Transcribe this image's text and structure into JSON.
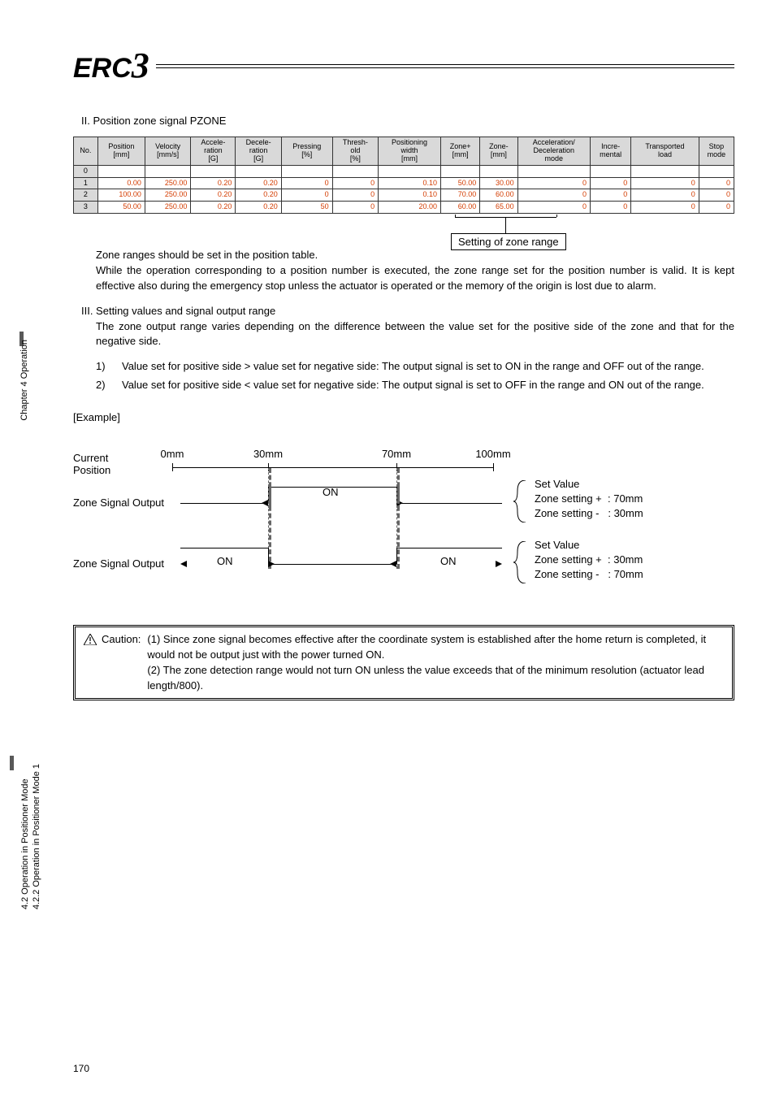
{
  "logo_text": "ERC3",
  "section2_title": "II. Position zone signal PZONE",
  "table": {
    "headers": [
      "No.",
      "Position\n[mm]",
      "Velocity\n[mm/s]",
      "Acceleration\n[G]",
      "Deceleration\n[G]",
      "Pressing\n[%]",
      "Threshold\n[%]",
      "Positioning\nwidth\n[mm]",
      "Zone+\n[mm]",
      "Zone-\n[mm]",
      "Acceleration/\nDeceleration\nmode",
      "Incremental",
      "Transported\nload",
      "Stop\nmode"
    ],
    "h0": "No.",
    "h1": "Position [mm]",
    "h2": "Velocity [mm/s]",
    "h3": "Acceleration [G]",
    "h4": "Deceleration [G]",
    "h5": "Pressing [%]",
    "h6": "Threshold [%]",
    "h7": "Positioning width [mm]",
    "h8": "Zone+ [mm]",
    "h9": "Zone- [mm]",
    "h10": "Acceleration/ Deceleration mode",
    "h11": "Incremental",
    "h12": "Transported load",
    "h13": "Stop mode",
    "rows": [
      {
        "no": "0",
        "cells": [
          "",
          "",
          "",
          "",
          "",
          "",
          "",
          "",
          "",
          "",
          "",
          "",
          ""
        ]
      },
      {
        "no": "1",
        "cells": [
          "0.00",
          "250.00",
          "0.20",
          "0.20",
          "0",
          "0",
          "0.10",
          "50.00",
          "30.00",
          "0",
          "0",
          "0",
          "0"
        ]
      },
      {
        "no": "2",
        "cells": [
          "100.00",
          "250.00",
          "0.20",
          "0.20",
          "0",
          "0",
          "0.10",
          "70.00",
          "60.00",
          "0",
          "0",
          "0",
          "0"
        ]
      },
      {
        "no": "3",
        "cells": [
          "50.00",
          "250.00",
          "0.20",
          "0.20",
          "50",
          "0",
          "20.00",
          "60.00",
          "65.00",
          "0",
          "0",
          "0",
          "0"
        ]
      }
    ]
  },
  "callout": "Setting of zone range",
  "para1": "Zone ranges should be set in the position table.\nWhile the operation corresponding to a position number is executed, the zone range set for the position number is valid. It is kept effective also during the emergency stop unless the actuator is operated or the memory of the origin is lost due to alarm.",
  "para1_a": "Zone ranges should be set in the position table.",
  "para1_b": "While the operation corresponding to a position number is executed, the zone range set for the position number is valid. It is kept effective also during the emergency stop unless the actuator is operated or the memory of the origin is lost due to alarm.",
  "section3_title": "III. Setting values and signal output range",
  "para2": "The zone output range varies depending on the difference between the value set for the positive side of the zone and that for the negative side.",
  "list": [
    {
      "n": "1)",
      "t": "Value set for positive side > value set for negative side: The output signal is set to ON in the range and OFF out of the range."
    },
    {
      "n": "2)",
      "t": "Value set for positive side < value set for negative side: The output signal is set to OFF in the range and ON out of the range."
    }
  ],
  "example_label": "[Example]",
  "diagram": {
    "current_position": "Current\nPosition",
    "cp1": "Current",
    "cp2": "Position",
    "ticks": {
      "t0": "0mm",
      "t30": "30mm",
      "t70": "70mm",
      "t100": "100mm"
    },
    "zone_signal_output": "Zone Signal Output",
    "on": "ON",
    "set_value": "Set Value",
    "zs_plus": "Zone setting +",
    "zs_minus": "Zone setting -",
    "v70": ": 70mm",
    "v30": ": 30mm"
  },
  "caution": {
    "label": "Caution:",
    "c1": "(1) Since zone signal becomes effective after the coordinate system is established after the home return is completed, it would not be output just with the power turned ON.",
    "c2": "(2) The zone detection range would not turn ON unless the value exceeds that of the minimum resolution (actuator lead length/800)."
  },
  "sidebar": {
    "ch": "Chapter 4 Operation",
    "s1": "4.2 Operation in Positioner Mode",
    "s2": "4.2.2 Operation in Positioner Mode 1"
  },
  "page_number": "170"
}
